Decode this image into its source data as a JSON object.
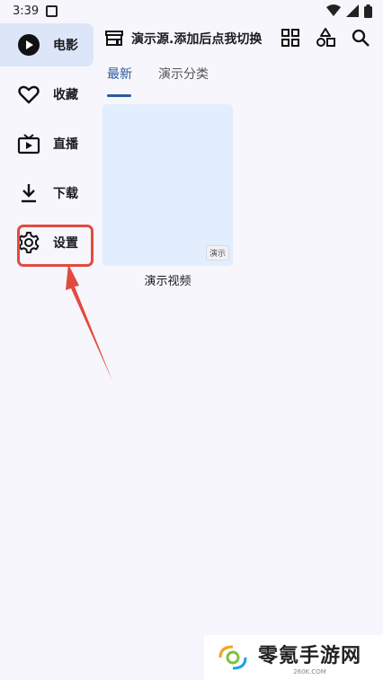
{
  "status_bar": {
    "time": "3:39"
  },
  "sidebar": {
    "items": [
      {
        "label": "电影",
        "icon": "play-circle-icon",
        "active": true
      },
      {
        "label": "收藏",
        "icon": "heart-icon",
        "active": false
      },
      {
        "label": "直播",
        "icon": "tv-icon",
        "active": false
      },
      {
        "label": "下载",
        "icon": "download-icon",
        "active": false
      },
      {
        "label": "设置",
        "icon": "gear-icon",
        "active": false
      }
    ]
  },
  "header": {
    "source_title": "演示源.添加后点我切换",
    "icons": [
      "grid-icon",
      "category-shapes-icon",
      "search-icon"
    ]
  },
  "tabs": [
    {
      "label": "最新",
      "active": true
    },
    {
      "label": "演示分类",
      "active": false
    }
  ],
  "videos": [
    {
      "title": "演示视频",
      "badge": "演示"
    }
  ],
  "watermark": {
    "title": "零氪手游网",
    "sub": "260K.COM"
  },
  "colors": {
    "accent": "#2b5b9a",
    "active_nav_bg": "#dce6f8",
    "highlight": "#e34a3e",
    "card_bg": "#e2edfd"
  }
}
